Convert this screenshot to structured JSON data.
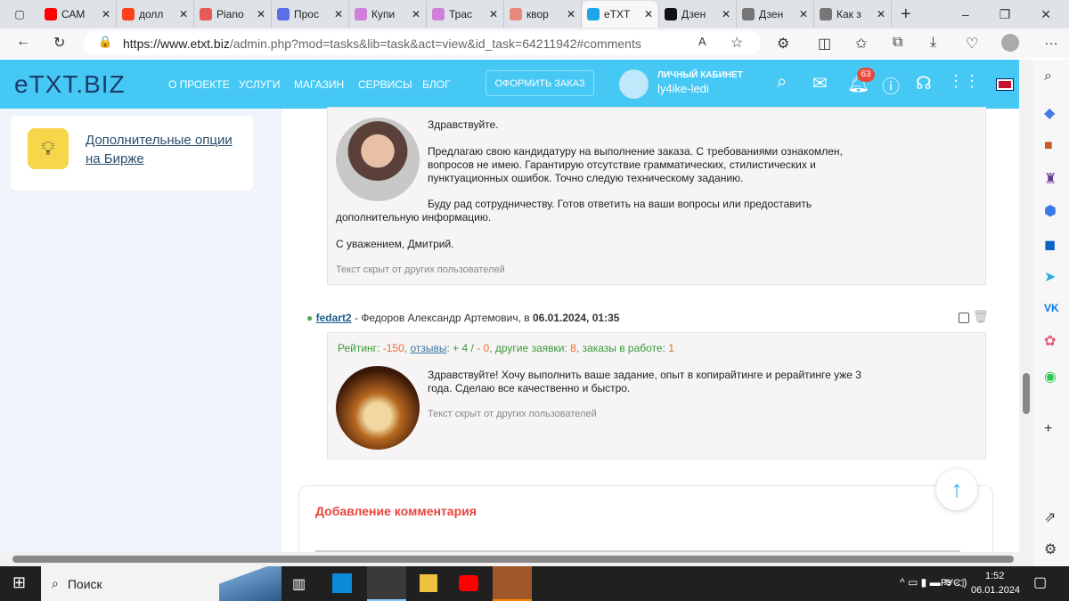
{
  "browser": {
    "tabs": [
      {
        "label": "САМ",
        "color": "#ff0000"
      },
      {
        "label": "долл",
        "color": "#fc3f1d"
      },
      {
        "label": "Piano",
        "color": "#e85a5a"
      },
      {
        "label": "Прос",
        "color": "#5a6ee8"
      },
      {
        "label": "Купи",
        "color": "#d080d8"
      },
      {
        "label": "Трас",
        "color": "#d080d8"
      },
      {
        "label": "квор",
        "color": "#e8887a"
      },
      {
        "label": "eTXT",
        "color": "#1ea6e8",
        "active": true
      },
      {
        "label": "Дзен",
        "color": "#111"
      },
      {
        "label": "Дзен",
        "color": "#777"
      },
      {
        "label": "Как з",
        "color": "#777"
      }
    ],
    "url_host": "https://www.etxt.biz",
    "url_path": "/admin.php?mod=tasks&lib=task&act=view&id_task=64211942#comments"
  },
  "header": {
    "logo": "eTXT.BIZ",
    "nav": [
      "О ПРОЕКТЕ",
      "УСЛУГИ",
      "МАГАЗИН",
      "СЕРВИСЫ",
      "БЛОГ"
    ],
    "order_button": "ОФОРМИТЬ ЗАКАЗ",
    "cabinet_label": "ЛИЧНЫЙ КАБИНЕТ",
    "username": "ly4ike-ledi",
    "notifications": "63",
    "accent": "#46c8f5"
  },
  "sidebar": {
    "card_link": "Дополнительные опции на Бирже"
  },
  "comments": [
    {
      "paragraphs": [
        "Здравствуйте.",
        "Предлагаю свою кандидатуру на выполнение заказа. С требованиями ознакомлен, вопросов не имею. Гарантирую отсутствие грамматических, стилистических и пунктуационных ошибок. Точно следую техническому заданию.",
        "Буду рад сотрудничеству. Готов ответить на ваши вопросы или предоставить дополнительную информацию.",
        "С уважением, Дмитрий."
      ],
      "hidden": "Текст скрыт от других пользователей"
    },
    {
      "user": "fedart2",
      "name": " - Федоров Александр Артемович, в ",
      "date": "06.01.2024, 01:35",
      "rating_label": "Рейтинг: ",
      "rating": "-150",
      "reviews_label": "отзывы",
      "reviews_plus": ": + 4 / ",
      "reviews_minus": "- 0",
      "other_label": ", другие заявки: ",
      "other": "8",
      "work_label": ", заказы в работе: ",
      "work": "1",
      "text": "Здравствуйте! Хочу выполнить ваше задание, опыт в копирайтинге и рерайтинге уже 3 года. Сделаю все качественно и быстро.",
      "hidden": "Текст скрыт от других пользователей"
    }
  ],
  "add_comment": {
    "title": "Добавление комментария"
  },
  "taskbar": {
    "search": "Поиск",
    "lang": "РУС",
    "time": "1:52",
    "date": "06.01.2024"
  }
}
